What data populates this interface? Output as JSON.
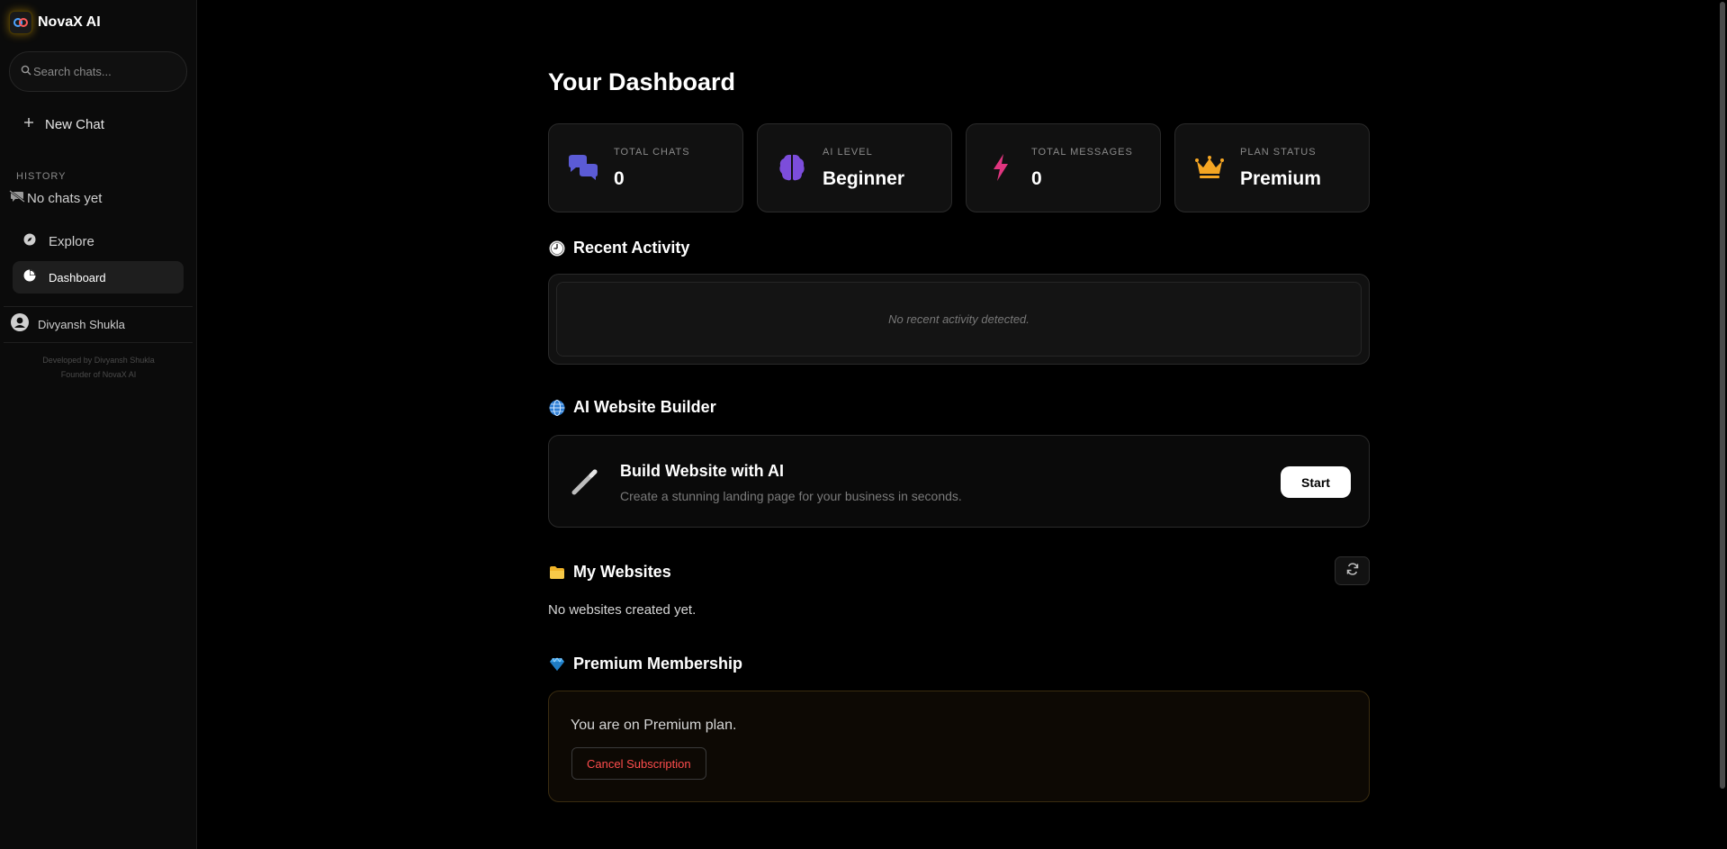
{
  "app": {
    "title": "NovaX AI"
  },
  "sidebar": {
    "search_placeholder": "Search chats...",
    "new_chat_label": "New Chat",
    "history_label": "HISTORY",
    "no_chats": "No chats yet",
    "nav": [
      {
        "label": "Explore",
        "icon": "compass-icon"
      },
      {
        "label": "Dashboard",
        "icon": "pie-chart-icon",
        "active": true
      }
    ],
    "user_name": "Divyansh Shukla",
    "credit_line1": "Developed by Divyansh Shukla",
    "credit_line2": "Founder of NovaX AI"
  },
  "main": {
    "title": "Your Dashboard",
    "stats": [
      {
        "label": "TOTAL CHATS",
        "value": "0",
        "icon": "chat-bubbles-icon",
        "color": "#5b5bd6"
      },
      {
        "label": "AI LEVEL",
        "value": "Beginner",
        "icon": "brain-icon",
        "color": "#7c4ddb"
      },
      {
        "label": "TOTAL MESSAGES",
        "value": "0",
        "icon": "bolt-icon",
        "color": "#e0357f"
      },
      {
        "label": "PLAN STATUS",
        "value": "Premium",
        "icon": "crown-icon",
        "color": "#f5a623"
      }
    ],
    "recent_activity": {
      "title": "Recent Activity",
      "empty_text": "No recent activity detected."
    },
    "builder": {
      "section_title": "AI Website Builder",
      "card_title": "Build Website with AI",
      "card_subtitle": "Create a stunning landing page for your business in seconds.",
      "start_label": "Start"
    },
    "my_websites": {
      "title": "My Websites",
      "empty_text": "No websites created yet."
    },
    "premium": {
      "title": "Premium Membership",
      "status_text": "You are on Premium plan.",
      "cancel_label": "Cancel Subscription"
    }
  }
}
